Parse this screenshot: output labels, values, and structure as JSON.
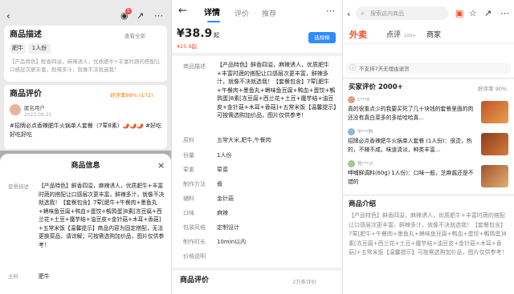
{
  "panel1": {
    "desc_title": "商品描述",
    "desc_link": "查看全部",
    "chips": [
      "肥牛",
      "1人份"
    ],
    "desc_preview": "【产品特色】鲜香四溢，麻辣诱人，优质肥牛+丰富时蔬的搭配让口感层次更丰富，鲜辣多汁，就像不决就选我！",
    "review_title": "商品评价",
    "review_rate": "好评率98% (172)",
    "reviewer": "匿名用户",
    "review_date": "2023.08.21",
    "review_text": "#招牌必点香辣肥牛火锅单人套餐（7荤8素）🌶️🌶️🌶️ #好吃好吃好吃",
    "sheet_title": "商品信息",
    "sheet_close": "×",
    "sheet_label": "套餐描述",
    "sheet_text": "【产品特色】鲜香四溢，麻辣诱人，优质肥牛+丰富时蔬的搭配让口感层次更丰富，鲜辣多汁，就像不决就选我！【套餐包含】7荤[肥牛+午餐肉+墨鱼丸+蟳味鱼豆腐+鸭血+蛋饺+鹌鹑蛋]8素[冻豆腐+西兰花+土豆+魔芋结+油豆皮+金针菇+木耳+香菇]+五常米饭【温馨提示】商品内容为固定搭配，无法更换菜品，请谅解；可按需选购加价品，图片仅供参考！",
    "main_label": "主料",
    "main_value": "肥牛"
  },
  "panel2": {
    "tabs": [
      "详情",
      "评价",
      "推荐"
    ],
    "price": "¥38.9",
    "price_suffix": "起",
    "price_sub": "¥25.9起",
    "select_btn": "选规格",
    "desc_label": "商品描述",
    "desc_text": "【产品特色】鲜香四溢，麻辣诱人，优质肥牛+丰富时蔬的搭配让口感层次更丰富，鲜辣多汁，就像不决就选我！【套餐包含】7荤[肥牛+午餐肉+墨鱼丸+蟳味鱼豆腐+鸭血+蛋饺+鹌鹑蛋]8素[冻豆腐+西兰花+土豆+魔芋结+油豆皮+金针菇+木耳+香菇]+五常米饭【温馨提示】可按需选购加价品，图片仅供参考！",
    "rows": [
      {
        "label": "原料",
        "value": "五常大米,肥牛,午餐肉"
      },
      {
        "label": "份量",
        "value": "1人份"
      },
      {
        "label": "荤素",
        "value": "荤菜"
      },
      {
        "label": "制作方法",
        "value": "煮"
      },
      {
        "label": "辅料",
        "value": "金针菇"
      },
      {
        "label": "口味",
        "value": "麻辣"
      },
      {
        "label": "包装风格",
        "value": "定制设计"
      },
      {
        "label": "制作时长",
        "value": "10min以内"
      },
      {
        "label": "价格说明",
        "value": ""
      }
    ],
    "review_title": "商品评价",
    "review_count": "2万条评价"
  },
  "panel3": {
    "search_placeholder": "搜索这内商品",
    "tabs": [
      "外卖",
      "点评",
      "商家"
    ],
    "tab_badge": "100+",
    "notice": "不支持7天无理由退货",
    "reviews_title": "买家评价 2000+",
    "reviews_rate": "好评率 90%",
    "reviews": [
      {
        "user": "1***8",
        "text": "真的很重点少的我要买死了几十块钱的套餐里面的肉还没有真白菜多的多给哈哈真..."
      },
      {
        "user": "甲***购",
        "text": "招牌必点香辣肥牛火锅单人套餐 (1人份)：很烫，热的，不辣不咸，味道清淡，种类丰富..."
      },
      {
        "user": "我***沙",
        "text": "呷哺鲜调料(60g) 1人份)：口味一般，芝麻酱还是不错的"
      }
    ],
    "intro_title": "商品介绍",
    "intro_text": "【产品特色】鲜香四溢，麻辣诱人，优质肥牛+丰富时蔬的搭配让口感层次更丰富，鲜辣多汁，就像不决就选我！【套餐包含】7荤[肥牛+午餐肉+墨鱼丸+蟳味鱼豆腐+鸭血+蛋饺+鹌鹑蛋]8素[冻豆腐+西兰花+土豆+魔芋结+油豆皮+金针菇+木耳+香菇]+五常米饭【温馨提示】可按需选购加价品，图片仅供参考！"
  },
  "colors": {
    "accent_red": "#ff4a26",
    "accent_blue": "#2e8cff",
    "rating_orange": "#ff7a00"
  }
}
